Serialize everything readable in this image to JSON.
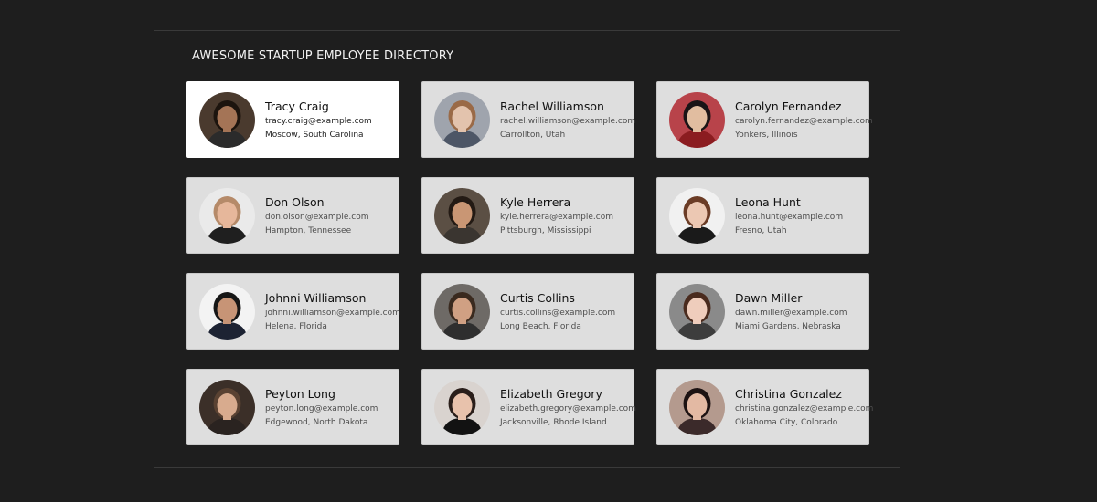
{
  "directory": {
    "title": "AWESOME STARTUP EMPLOYEE DIRECTORY",
    "employees": [
      {
        "name": "Tracy Craig",
        "email": "tracy.craig@example.com",
        "location": "Moscow, South Carolina",
        "bg": "#4a3a2e",
        "skin": "#a47456",
        "hair": "#1c140e",
        "shirt": "#2b2b2b"
      },
      {
        "name": "Rachel Williamson",
        "email": "rachel.williamson@example.com",
        "location": "Carrollton, Utah",
        "bg": "#9fa4ad",
        "skin": "#e3c3ad",
        "hair": "#9a6a47",
        "shirt": "#4d5666"
      },
      {
        "name": "Carolyn Fernandez",
        "email": "carolyn.fernandez@example.com",
        "location": "Yonkers, Illinois",
        "bg": "#b8434a",
        "skin": "#e1bda0",
        "hair": "#1a1416",
        "shirt": "#8b1c20"
      },
      {
        "name": "Don Olson",
        "email": "don.olson@example.com",
        "location": "Hampton, Tennessee",
        "bg": "#eaeaea",
        "skin": "#e6b79b",
        "hair": "#b58a69",
        "shirt": "#1f1f1f"
      },
      {
        "name": "Kyle Herrera",
        "email": "kyle.herrera@example.com",
        "location": "Pittsburgh, Mississippi",
        "bg": "#5b4f44",
        "skin": "#c99674",
        "hair": "#231a14",
        "shirt": "#3a3530"
      },
      {
        "name": "Leona Hunt",
        "email": "leona.hunt@example.com",
        "location": "Fresno, Utah",
        "bg": "#f1f1f1",
        "skin": "#ecc8b3",
        "hair": "#6b3c26",
        "shirt": "#1a1a1a"
      },
      {
        "name": "Johnni Williamson",
        "email": "johnni.williamson@example.com",
        "location": "Helena, Florida",
        "bg": "#f3f3f3",
        "skin": "#c79476",
        "hair": "#161616",
        "shirt": "#1d2333"
      },
      {
        "name": "Curtis Collins",
        "email": "curtis.collins@example.com",
        "location": "Long Beach, Florida",
        "bg": "#6e6a66",
        "skin": "#d0a083",
        "hair": "#3a2a1f",
        "shirt": "#2e2e2e"
      },
      {
        "name": "Dawn Miller",
        "email": "dawn.miller@example.com",
        "location": "Miami Gardens, Nebraska",
        "bg": "#8a8a8a",
        "skin": "#efcdbc",
        "hair": "#4a2b1e",
        "shirt": "#3d3d3d"
      },
      {
        "name": "Peyton Long",
        "email": "peyton.long@example.com",
        "location": "Edgewood, North Dakota",
        "bg": "#3b2f28",
        "skin": "#d8ab8e",
        "hair": "#5a4232",
        "shirt": "#2a2320"
      },
      {
        "name": "Elizabeth Gregory",
        "email": "elizabeth.gregory@example.com",
        "location": "Jacksonville, Rhode Island",
        "bg": "#d9d3cf",
        "skin": "#e8c2ac",
        "hair": "#2a1e1a",
        "shirt": "#121212"
      },
      {
        "name": "Christina Gonzalez",
        "email": "christina.gonzalez@example.com",
        "location": "Oklahoma City, Colorado",
        "bg": "#b49a8e",
        "skin": "#e3b9a3",
        "hair": "#1c1212",
        "shirt": "#3b2a2a"
      }
    ]
  }
}
